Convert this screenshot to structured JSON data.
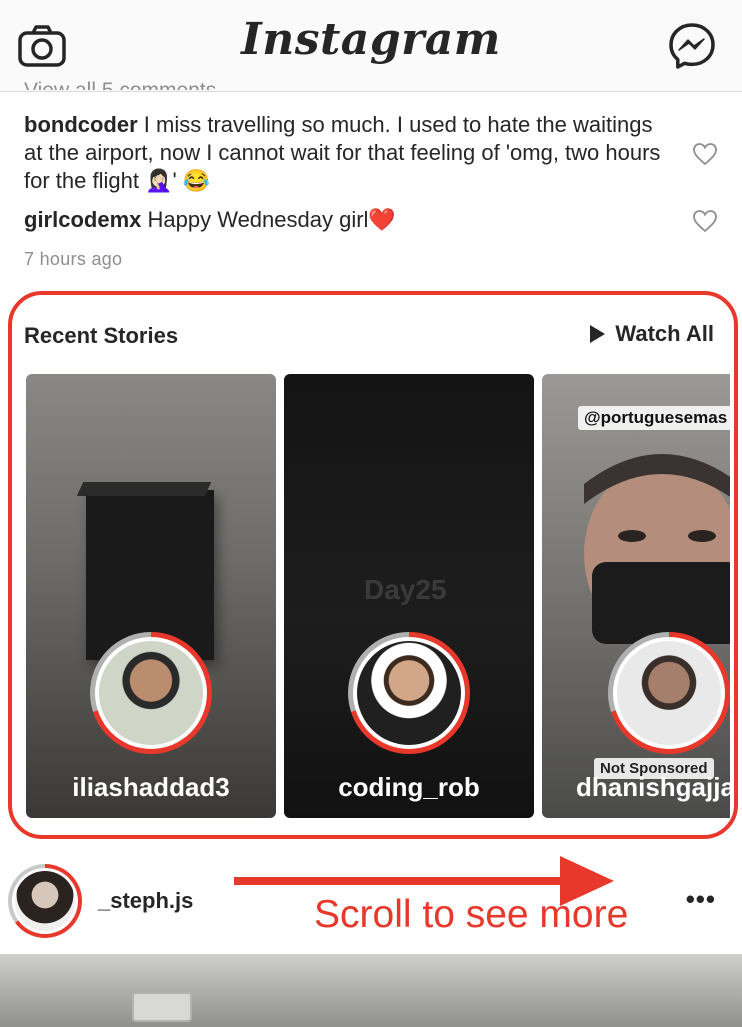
{
  "header": {
    "title": "Instagram",
    "left_icon": "camera-icon",
    "right_icon": "messenger-icon"
  },
  "comments": [
    {
      "user": "bondcoder",
      "text": "I miss travelling so much. I used to hate the waitings at the airport, now I cannot wait for that feeling of 'omg, two hours for the flight 🤦🏻‍♀️' 😂"
    },
    {
      "user": "girlcodemx",
      "text": "Happy Wednesday girl❤️"
    }
  ],
  "timestamp": "7 hours ago",
  "stories": {
    "title": "Recent Stories",
    "watch_all": "Watch All",
    "items": [
      {
        "name": "iliashaddad3"
      },
      {
        "name": "coding_rob",
        "overlay": "Day25"
      },
      {
        "name": "dhanishgajjar",
        "tag": "@portuguesemas",
        "sticker": "Not Sponsored"
      }
    ]
  },
  "post": {
    "username": "_steph.js",
    "more": "•••"
  },
  "annotation": {
    "text": "Scroll to see more",
    "color": "#e8382b"
  }
}
